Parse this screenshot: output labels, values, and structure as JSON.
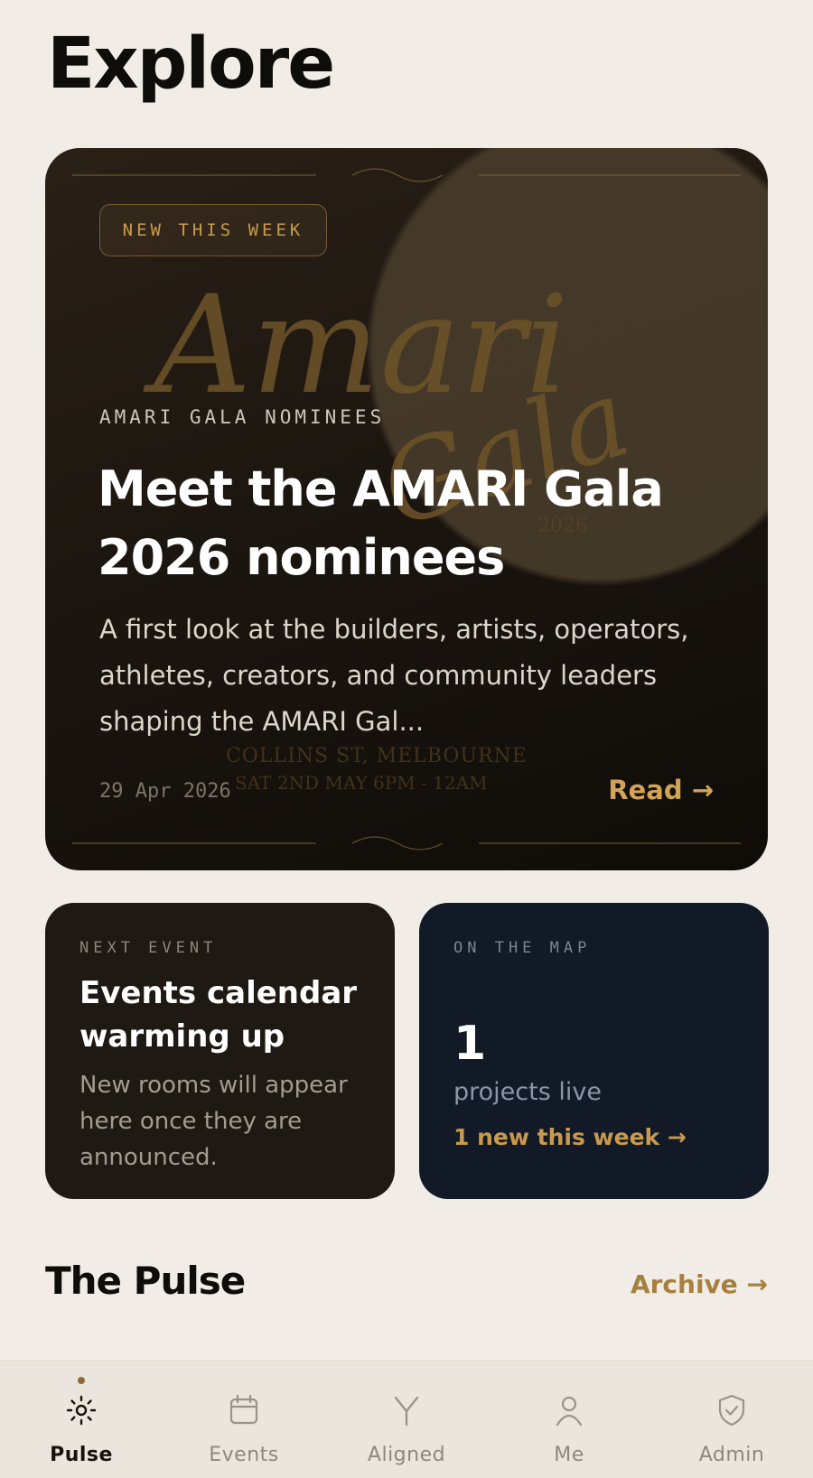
{
  "header": {
    "title": "Explore"
  },
  "hero": {
    "badge": "NEW THIS WEEK",
    "eyebrow": "AMARI GALA NOMINEES",
    "title": "Meet the AMARI Gala 2026 nominees",
    "description": "A first look at the builders, artists, operators, athletes, creators, and community leaders shaping the AMARI Gal...",
    "date": "29 Apr 2026",
    "read_label": "Read →",
    "poster_script_a": "Amari",
    "poster_script_b": "Gala",
    "poster_year": "2026",
    "poster_venue": "COLLINS ST, MELBOURNE",
    "poster_time": "SAT 2ND MAY        6PM - 12AM",
    "accent_color": "#c99c4e"
  },
  "cards": {
    "event": {
      "eyebrow": "NEXT EVENT",
      "title": "Events calendar warming up",
      "description": "New rooms will appear here once they are announced."
    },
    "map": {
      "eyebrow": "ON THE MAP",
      "count": "1",
      "label": "projects live",
      "link": "1 new this week →"
    }
  },
  "section": {
    "title": "The Pulse",
    "archive_label": "Archive →"
  },
  "nav": {
    "active": "Pulse",
    "items": [
      {
        "label": "Pulse",
        "icon": "sun-icon"
      },
      {
        "label": "Events",
        "icon": "calendar-icon"
      },
      {
        "label": "Aligned",
        "icon": "merge-icon"
      },
      {
        "label": "Me",
        "icon": "person-icon"
      },
      {
        "label": "Admin",
        "icon": "shield-check-icon"
      }
    ]
  }
}
